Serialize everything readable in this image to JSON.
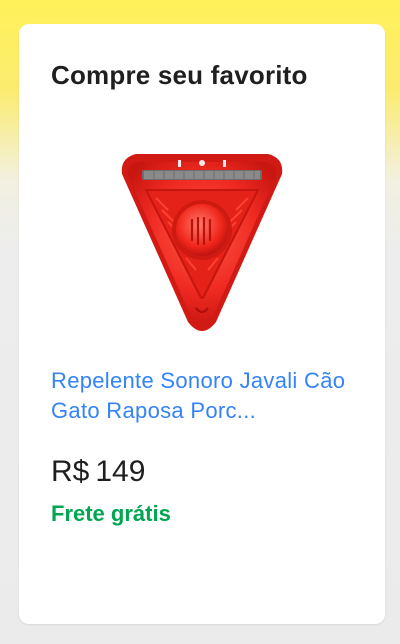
{
  "card": {
    "title": "Compre seu favorito",
    "product": {
      "title": "Repelente Sonoro Javali Cão Gato Raposa Porc...",
      "currency": "R$",
      "price": "149",
      "shipping": "Frete grátis"
    }
  },
  "colors": {
    "header_yellow": "#fff159",
    "link_blue": "#3483fa",
    "shipping_green": "#00a650",
    "product_red": "#e8231e"
  }
}
